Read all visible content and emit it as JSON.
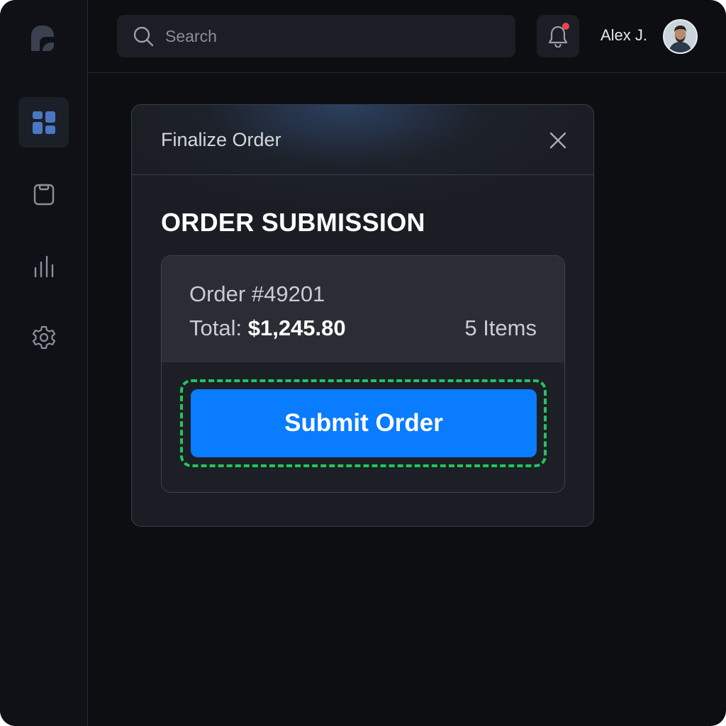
{
  "user": {
    "name": "Alex J."
  },
  "search": {
    "placeholder": "Search"
  },
  "sidebar": {
    "items": [
      {
        "icon": "dashboard-icon",
        "active": true
      },
      {
        "icon": "clipboard-icon",
        "active": false
      },
      {
        "icon": "chart-icon",
        "active": false
      },
      {
        "icon": "settings-icon",
        "active": false
      }
    ]
  },
  "notifications": {
    "icon": "bell-icon",
    "has_unread": true
  },
  "modal": {
    "title": "Finalize Order",
    "section_title": "ORDER SUBMISSION",
    "order": {
      "number": "Order #49201",
      "total_label": "Total: ",
      "total_amount": "$1,245.80",
      "items": "5 Items"
    },
    "submit_label": "Submit Order"
  },
  "colors": {
    "accent": "#0a7cff",
    "focus_ring": "#22c55e",
    "notification_dot": "#e5484d",
    "background": "#0c0e12"
  }
}
